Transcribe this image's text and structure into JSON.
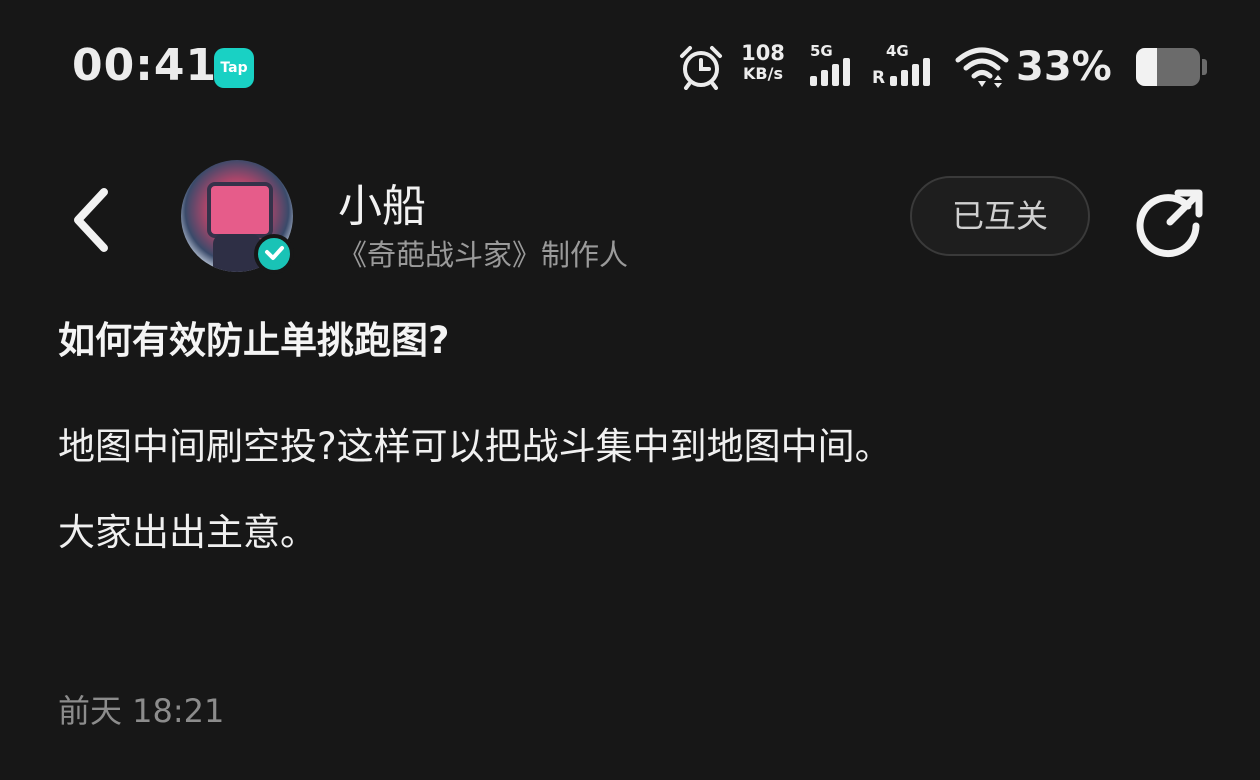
{
  "status_bar": {
    "time": "00:41",
    "app_badge": "Tap",
    "net_speed_value": "108",
    "net_speed_unit": "KB/s",
    "sim1_label": "5G",
    "sim2_label": "4G",
    "sim2_roaming": "R",
    "battery_percent": "33%",
    "battery_level": 0.33
  },
  "header": {
    "user_name": "小船",
    "user_role": "《奇葩战斗家》制作人",
    "follow_label": "已互关"
  },
  "post": {
    "title": "如何有效防止单挑跑图?",
    "body": [
      "地图中间刷空投?这样可以把战斗集中到地图中间。",
      "大家出出主意。"
    ],
    "timestamp": "前天 18:21"
  },
  "colors": {
    "background": "#171717",
    "accent_teal": "#19d1c4",
    "secondary_text": "#9a9a9a"
  },
  "icons": {
    "back": "chevron-left-icon",
    "share": "share-icon",
    "verified": "verified-check-icon",
    "alarm": "alarm-clock-icon",
    "wifi": "wifi-icon"
  }
}
